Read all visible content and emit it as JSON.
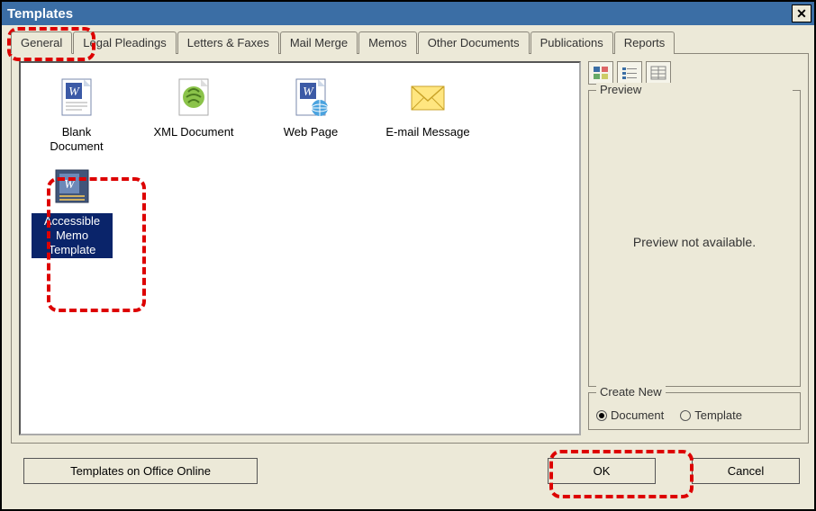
{
  "title": "Templates",
  "tabs": [
    {
      "label": "General",
      "active": true
    },
    {
      "label": "Legal Pleadings"
    },
    {
      "label": "Letters & Faxes"
    },
    {
      "label": "Mail Merge"
    },
    {
      "label": "Memos"
    },
    {
      "label": "Other Documents"
    },
    {
      "label": "Publications"
    },
    {
      "label": "Reports"
    }
  ],
  "items": [
    {
      "label": "Blank Document",
      "icon": "word-doc"
    },
    {
      "label": "XML Document",
      "icon": "xml-doc"
    },
    {
      "label": "Web Page",
      "icon": "web-page"
    },
    {
      "label": "E-mail Message",
      "icon": "email"
    },
    {
      "label": "Accessible Memo Template",
      "icon": "memo",
      "selected": true
    }
  ],
  "preview": {
    "legend": "Preview",
    "text": "Preview not available."
  },
  "create_new": {
    "legend": "Create New",
    "options": [
      {
        "label": "Document",
        "checked": true
      },
      {
        "label": "Template",
        "checked": false
      }
    ]
  },
  "buttons": {
    "templates_online": "Templates on Office Online",
    "ok": "OK",
    "cancel": "Cancel"
  }
}
